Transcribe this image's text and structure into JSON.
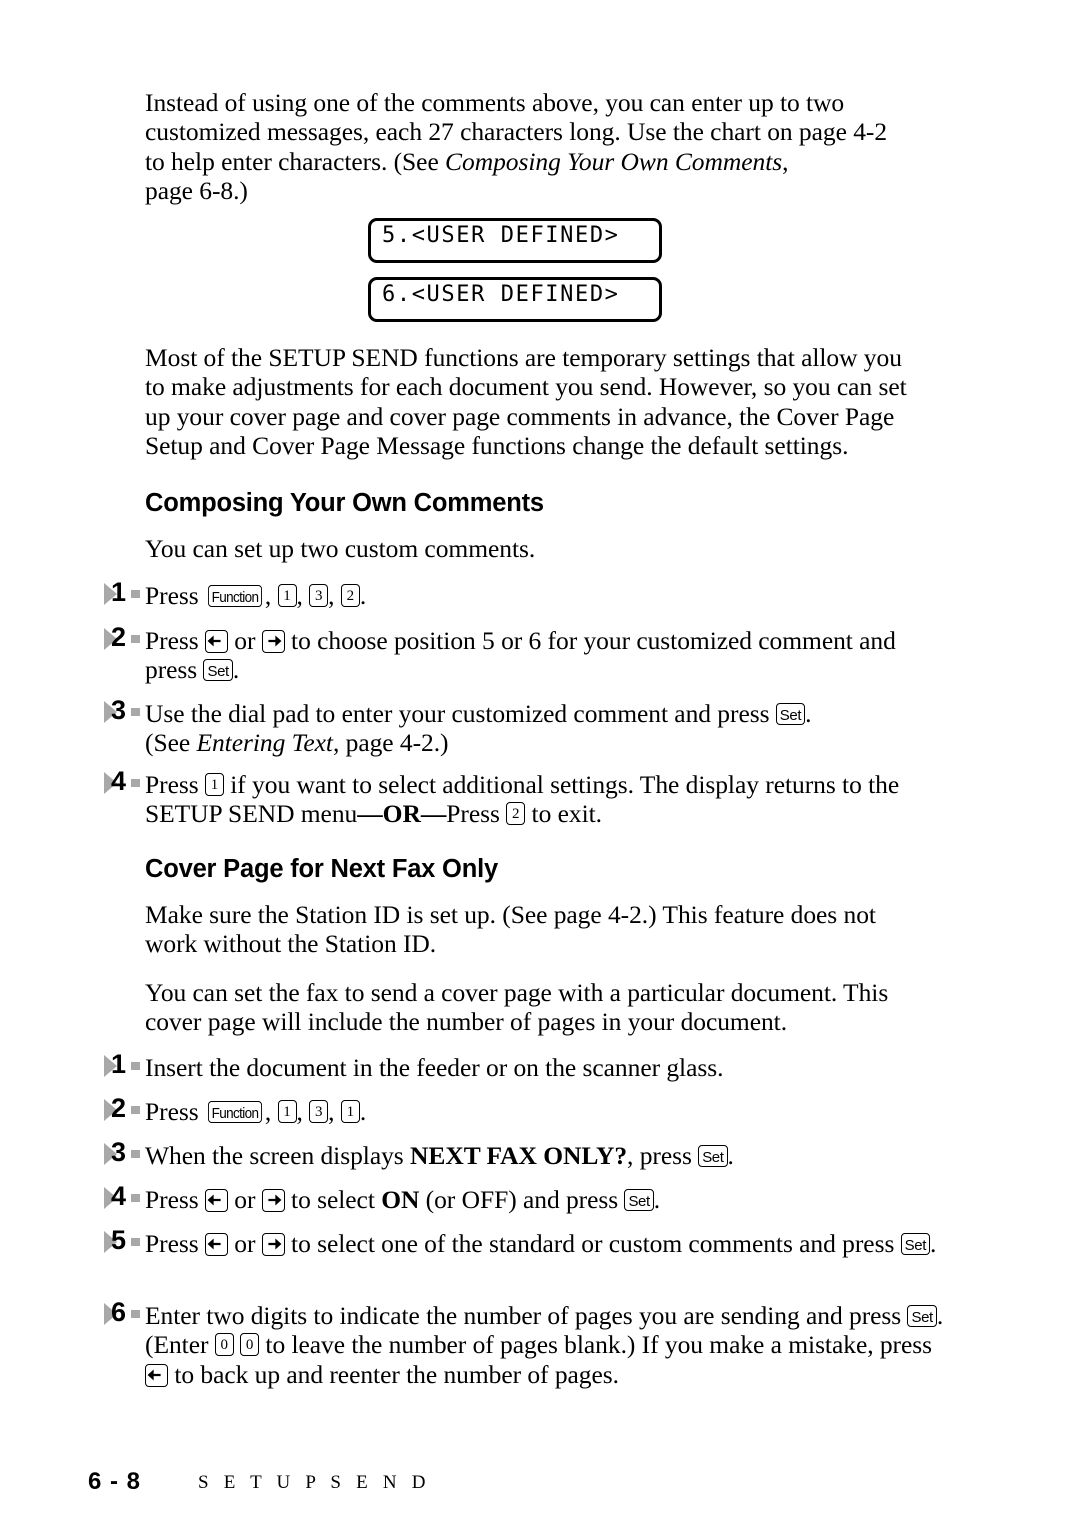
{
  "document": {
    "page_label": "6 - 8",
    "footer_title": "S E T U P   S E N D"
  },
  "intro": {
    "line1": "Instead of using one of the comments above, you can enter up to two",
    "line2": "customized messages, each 27 characters long. Use the chart on page 4-2",
    "line3_before": "to help enter characters. (See ",
    "line3_italic": "Composing Your Own Comments",
    "line3_after": ",",
    "line4": "page 6-8.)"
  },
  "lcd_displays": [
    {
      "text": "5.<USER DEFINED>"
    },
    {
      "text": "6.<USER DEFINED>"
    }
  ],
  "setup_send_para": {
    "line1": "Most of the SETUP SEND functions are temporary settings that allow you",
    "line2": "to make adjustments for each document you send. However, so you can set",
    "line3": "up your cover page and cover page comments in advance, the Cover Page",
    "line4": "Setup and Cover Page Message functions change the default settings."
  },
  "section_composing": {
    "heading": "Composing Your Own Comments",
    "intro": "You can set up two custom comments.",
    "steps": [
      {
        "number": "1",
        "parts": [
          {
            "type": "text",
            "value": "Press "
          },
          {
            "type": "key",
            "variant": "fn",
            "label": "Function"
          },
          {
            "type": "text",
            "value": ", "
          },
          {
            "type": "key",
            "variant": "num",
            "label": "1"
          },
          {
            "type": "text",
            "value": ", "
          },
          {
            "type": "key",
            "variant": "num",
            "label": "3"
          },
          {
            "type": "text",
            "value": ", "
          },
          {
            "type": "key",
            "variant": "num",
            "label": "2"
          },
          {
            "type": "text",
            "value": "."
          }
        ]
      },
      {
        "number": "2",
        "parts": [
          {
            "type": "text",
            "value": "Press "
          },
          {
            "type": "key",
            "variant": "arrow-left",
            "label": "left-arrow"
          },
          {
            "type": "text",
            "value": " or "
          },
          {
            "type": "key",
            "variant": "arrow-right",
            "label": "right-arrow"
          },
          {
            "type": "text",
            "value": " to choose position 5 or 6 for your customized comment and press "
          },
          {
            "type": "key",
            "variant": "set",
            "label": "Set"
          },
          {
            "type": "text",
            "value": "."
          }
        ]
      },
      {
        "number": "3",
        "parts": [
          {
            "type": "text",
            "value": "Use the dial pad to enter your customized comment and press "
          },
          {
            "type": "key",
            "variant": "set",
            "label": "Set"
          },
          {
            "type": "text",
            "value": "."
          },
          {
            "type": "break"
          },
          {
            "type": "text",
            "value": "(See "
          },
          {
            "type": "italic",
            "value": "Entering Text"
          },
          {
            "type": "text",
            "value": ", page 4-2.)"
          }
        ]
      },
      {
        "number": "4",
        "parts": [
          {
            "type": "text",
            "value": "Press "
          },
          {
            "type": "key",
            "variant": "num",
            "label": "1"
          },
          {
            "type": "text",
            "value": " if you want to select additional settings. The display returns to the SETUP SEND menu"
          },
          {
            "type": "bold",
            "value": "—OR—"
          },
          {
            "type": "text",
            "value": "Press "
          },
          {
            "type": "key",
            "variant": "num",
            "label": "2"
          },
          {
            "type": "text",
            "value": " to exit."
          }
        ]
      }
    ]
  },
  "section_cover_page": {
    "heading": "Cover Page for Next Fax Only",
    "para1": {
      "line1": "Make sure the Station ID is set up. (See page 4-2.) This feature does not",
      "line2": "work without the Station ID."
    },
    "para2": {
      "line1": "You can set the fax to send a cover page with a particular document. This",
      "line2": "cover page will include the number of pages in your document."
    },
    "steps": [
      {
        "number": "1",
        "parts": [
          {
            "type": "text",
            "value": "Insert the document in the feeder or on the scanner glass."
          }
        ]
      },
      {
        "number": "2",
        "parts": [
          {
            "type": "text",
            "value": "Press "
          },
          {
            "type": "key",
            "variant": "fn",
            "label": "Function"
          },
          {
            "type": "text",
            "value": ", "
          },
          {
            "type": "key",
            "variant": "num",
            "label": "1"
          },
          {
            "type": "text",
            "value": ", "
          },
          {
            "type": "key",
            "variant": "num",
            "label": "3"
          },
          {
            "type": "text",
            "value": ", "
          },
          {
            "type": "key",
            "variant": "num",
            "label": "1"
          },
          {
            "type": "text",
            "value": "."
          }
        ]
      },
      {
        "number": "3",
        "parts": [
          {
            "type": "text",
            "value": "When the screen displays "
          },
          {
            "type": "bold",
            "value": "NEXT FAX ONLY?"
          },
          {
            "type": "text",
            "value": ", press "
          },
          {
            "type": "key",
            "variant": "set",
            "label": "Set"
          },
          {
            "type": "text",
            "value": "."
          }
        ]
      },
      {
        "number": "4",
        "parts": [
          {
            "type": "text",
            "value": "Press "
          },
          {
            "type": "key",
            "variant": "arrow-left",
            "label": "left-arrow"
          },
          {
            "type": "text",
            "value": " or "
          },
          {
            "type": "key",
            "variant": "arrow-right",
            "label": "right-arrow"
          },
          {
            "type": "text",
            "value": " to select "
          },
          {
            "type": "bold",
            "value": "ON"
          },
          {
            "type": "text",
            "value": " (or OFF) and press "
          },
          {
            "type": "key",
            "variant": "set",
            "label": "Set"
          },
          {
            "type": "text",
            "value": "."
          }
        ]
      },
      {
        "number": "5",
        "parts": [
          {
            "type": "text",
            "value": "Press "
          },
          {
            "type": "key",
            "variant": "arrow-left",
            "label": "left-arrow"
          },
          {
            "type": "text",
            "value": " or "
          },
          {
            "type": "key",
            "variant": "arrow-right",
            "label": "right-arrow"
          },
          {
            "type": "text",
            "value": " to select one of the standard or custom comments and press "
          },
          {
            "type": "key",
            "variant": "set",
            "label": "Set"
          },
          {
            "type": "text",
            "value": "."
          }
        ]
      },
      {
        "number": "6",
        "parts": [
          {
            "type": "text",
            "value": "Enter two digits to indicate the number of pages you are sending and press "
          },
          {
            "type": "key",
            "variant": "set",
            "label": "Set"
          },
          {
            "type": "text",
            "value": "."
          },
          {
            "type": "break"
          },
          {
            "type": "text",
            "value": "(Enter "
          },
          {
            "type": "key",
            "variant": "num",
            "label": "0"
          },
          {
            "type": "text",
            "value": " "
          },
          {
            "type": "key",
            "variant": "num",
            "label": "0"
          },
          {
            "type": "text",
            "value": " to leave the number of pages blank.) If you make a mistake, press "
          },
          {
            "type": "key",
            "variant": "arrow-left",
            "label": "left-arrow"
          },
          {
            "type": "text",
            "value": " to back up and reenter the number of pages."
          }
        ]
      }
    ]
  }
}
